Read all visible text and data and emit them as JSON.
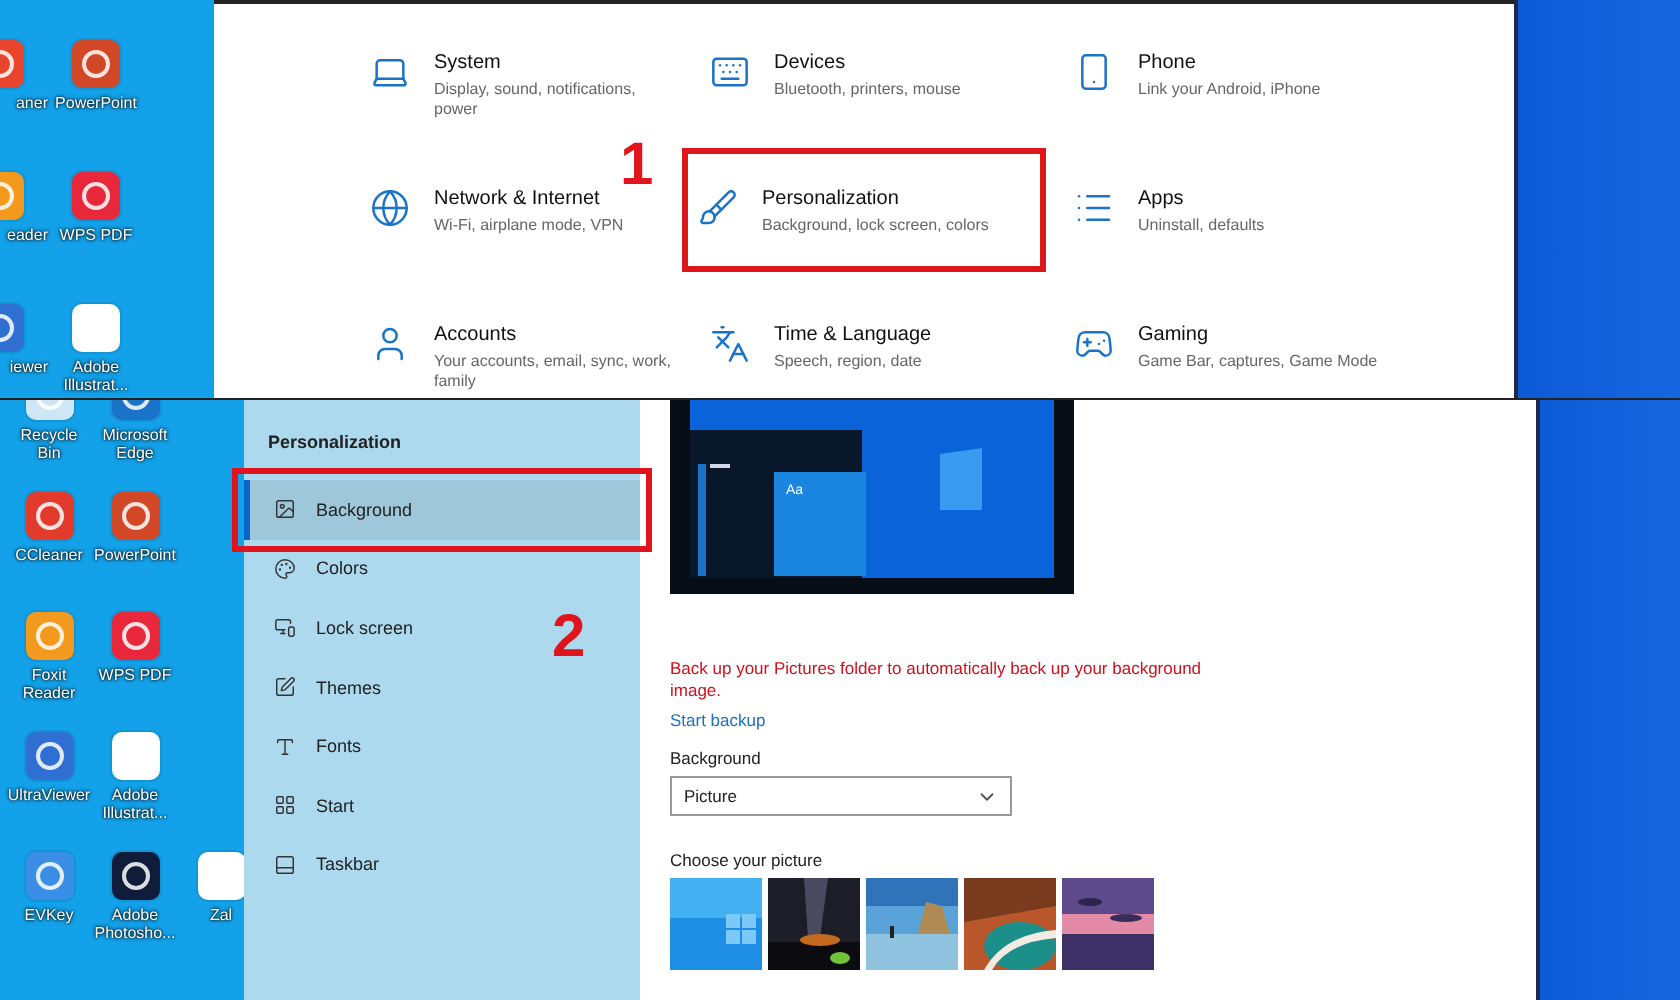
{
  "top_screen": {
    "desktop_icons": [
      {
        "label": "aner",
        "color": "#e8452c"
      },
      {
        "label": "PowerPoint",
        "color": "#d24726"
      },
      {
        "label": "eader",
        "color": "#f39a1e"
      },
      {
        "label": "WPS PDF",
        "color": "#e8283a"
      },
      {
        "label": "iewer",
        "color": "#2f6fd1"
      },
      {
        "label": "Adobe Illustrat...",
        "color": "#ffffff"
      }
    ],
    "settings": [
      {
        "title": "System",
        "description": "Display, sound, notifications, power",
        "highlighted": false
      },
      {
        "title": "Devices",
        "description": "Bluetooth, printers, mouse",
        "highlighted": false
      },
      {
        "title": "Phone",
        "description": "Link your Android, iPhone",
        "highlighted": false
      },
      {
        "title": "Network & Internet",
        "description": "Wi-Fi, airplane mode, VPN",
        "highlighted": false
      },
      {
        "title": "Personalization",
        "description": "Background, lock screen, colors",
        "highlighted": true
      },
      {
        "title": "Apps",
        "description": "Uninstall, defaults",
        "highlighted": false
      },
      {
        "title": "Accounts",
        "description": "Your accounts, email, sync, work, family",
        "highlighted": false
      },
      {
        "title": "Time & Language",
        "description": "Speech, region, date",
        "highlighted": false
      },
      {
        "title": "Gaming",
        "description": "Game Bar, captures, Game Mode",
        "highlighted": false
      }
    ],
    "annotation": "1"
  },
  "bottom_screen": {
    "desktop_icons": [
      {
        "label": "Recycle Bin",
        "color": "#cfe6f5"
      },
      {
        "label": "Microsoft Edge",
        "color": "#1a73c9"
      },
      {
        "label": "CCleaner",
        "color": "#e23b2b"
      },
      {
        "label": "PowerPoint",
        "color": "#d24726"
      },
      {
        "label": "Foxit Reader",
        "color": "#f39a1e"
      },
      {
        "label": "WPS PDF",
        "color": "#e8283a"
      },
      {
        "label": "UltraViewer",
        "color": "#2f6fd1"
      },
      {
        "label": "Adobe Illustrat...",
        "color": "#ffffff"
      },
      {
        "label": "EVKey",
        "color": "#3a8ee6"
      },
      {
        "label": "Adobe Photosho...",
        "color": "#0f1d3a"
      },
      {
        "label": "Zal",
        "color": "#ffffff"
      }
    ],
    "sidebar": {
      "heading": "Personalization",
      "items": [
        {
          "label": "Background",
          "selected": true,
          "highlighted": true
        },
        {
          "label": "Colors",
          "selected": false,
          "highlighted": false
        },
        {
          "label": "Lock screen",
          "selected": false,
          "highlighted": false
        },
        {
          "label": "Themes",
          "selected": false,
          "highlighted": false
        },
        {
          "label": "Fonts",
          "selected": false,
          "highlighted": false
        },
        {
          "label": "Start",
          "selected": false,
          "highlighted": false
        },
        {
          "label": "Taskbar",
          "selected": false,
          "highlighted": false
        }
      ]
    },
    "annotation": "2",
    "content": {
      "preview_tile_text": "Aa",
      "backup_message": "Back up your Pictures folder to automatically back up your background image.",
      "start_backup": "Start backup",
      "background_label": "Background",
      "background_value": "Picture",
      "choose_label": "Choose your picture"
    }
  }
}
